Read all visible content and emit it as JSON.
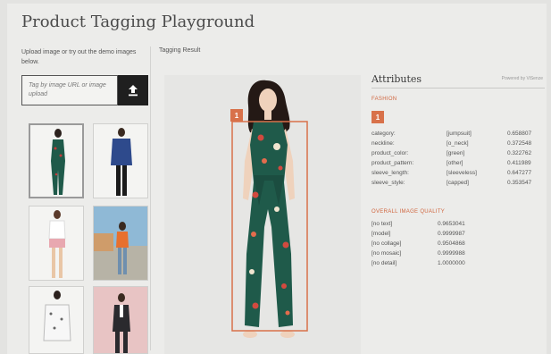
{
  "header": {
    "title": "Product Tagging Playground"
  },
  "left": {
    "instruction": "Upload image or try out the demo images below.",
    "url_placeholder": "Tag by image URL or image upload",
    "upload_icon": "upload-icon"
  },
  "result": {
    "label": "Tagging Result",
    "box_index": "1"
  },
  "attributes": {
    "title": "Attributes",
    "powered_by": "Powered by ViSenze",
    "section": "FASHION",
    "badge": "1",
    "rows": [
      {
        "key": "category:",
        "value": "[jumpsuit]",
        "score": "0.658807"
      },
      {
        "key": "neckline:",
        "value": "[o_neck]",
        "score": "0.372548"
      },
      {
        "key": "product_color:",
        "value": "[green]",
        "score": "0.322762"
      },
      {
        "key": "product_pattern:",
        "value": "[other]",
        "score": "0.411989"
      },
      {
        "key": "sleeve_length:",
        "value": "[sleeveless]",
        "score": "0.647277"
      },
      {
        "key": "sleeve_style:",
        "value": "[capped]",
        "score": "0.353547"
      }
    ],
    "quality_section": "OVERALL IMAGE QUALITY",
    "quality_rows": [
      {
        "key": "[no text]",
        "score": "0.9653041"
      },
      {
        "key": "[model]",
        "score": "0.9999987"
      },
      {
        "key": "[no collage]",
        "score": "0.9504868"
      },
      {
        "key": "[no mosaic]",
        "score": "0.9999988"
      },
      {
        "key": "[no detail]",
        "score": "1.0000000"
      }
    ]
  },
  "colors": {
    "accent": "#d8714a",
    "dress_green": "#1f5a4a",
    "text": "#3a3a3a"
  }
}
